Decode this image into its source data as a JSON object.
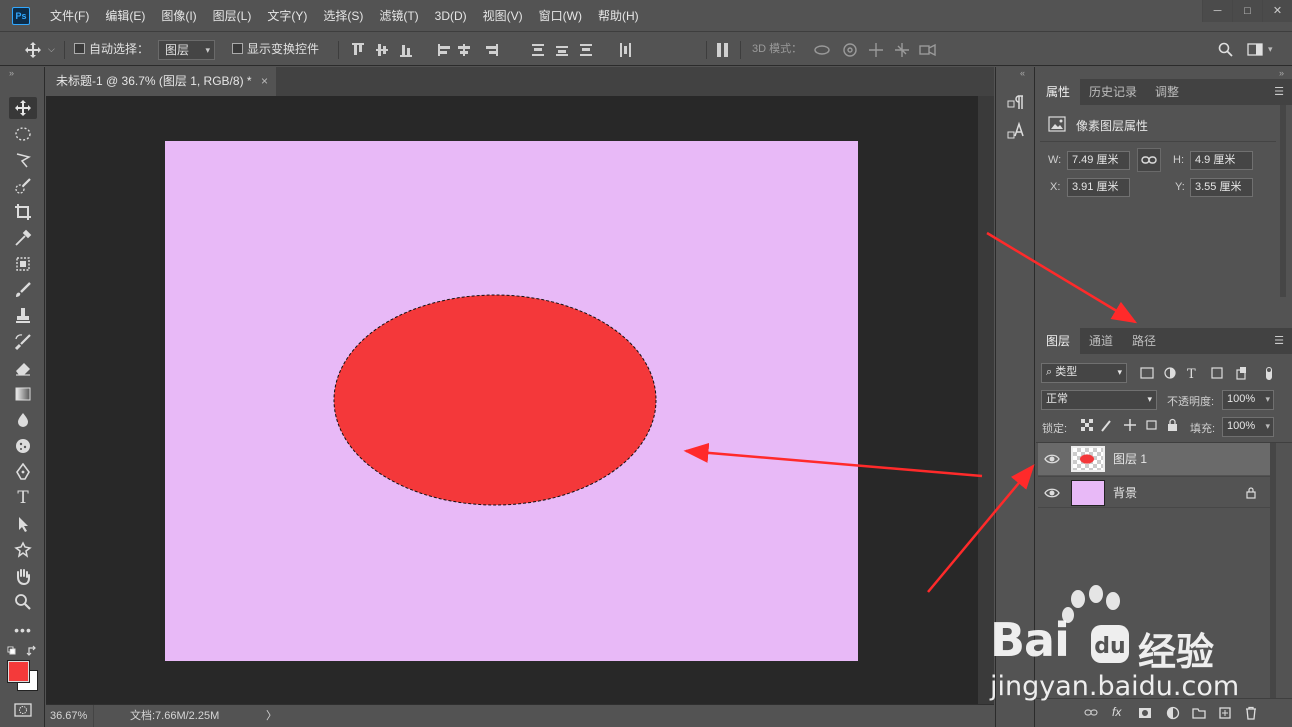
{
  "app": {
    "logo": "Ps"
  },
  "menu": [
    "文件(F)",
    "编辑(E)",
    "图像(I)",
    "图层(L)",
    "文字(Y)",
    "选择(S)",
    "滤镜(T)",
    "3D(D)",
    "视图(V)",
    "窗口(W)",
    "帮助(H)"
  ],
  "window_controls": {
    "minimize": "─",
    "restore": "□",
    "close": "✕"
  },
  "options": {
    "auto_select_label": "自动选择：",
    "auto_select_value": "图层",
    "show_transform_label": "显示变换控件",
    "mode_3d_label": "3D 模式："
  },
  "document": {
    "tab_title": "未标题-1 @ 36.7% (图层 1, RGB/8) *",
    "close": "×",
    "background_color": "#e8b9f7",
    "ellipse_color": "#f4383a"
  },
  "status": {
    "zoom": "36.67%",
    "doc_info": "文档:7.66M/2.25M",
    "arrow": "〉"
  },
  "properties": {
    "tabs": [
      "属性",
      "历史记录",
      "调整"
    ],
    "title": "像素图层属性",
    "w_label": "W:",
    "w_value": "7.49 厘米",
    "h_label": "H:",
    "h_value": "4.9 厘米",
    "x_label": "X:",
    "x_value": "3.91 厘米",
    "y_label": "Y:",
    "y_value": "3.55 厘米"
  },
  "layers": {
    "tabs": [
      "图层",
      "通道",
      "路径"
    ],
    "filter_label": "类型",
    "blend_mode": "正常",
    "opacity_label": "不透明度:",
    "opacity_value": "100%",
    "lock_label": "锁定:",
    "fill_label": "填充:",
    "fill_value": "100%",
    "items": [
      {
        "name": "图层 1"
      },
      {
        "name": "背景"
      }
    ],
    "footer_fx": "fx"
  },
  "colors": {
    "foreground": "#f43a3a",
    "background": "#ffffff",
    "annotation_arrow": "#ff2a2a"
  },
  "watermark": {
    "brand": "Bai",
    "brand2": "经验",
    "url": "jingyan.baidu.com"
  }
}
